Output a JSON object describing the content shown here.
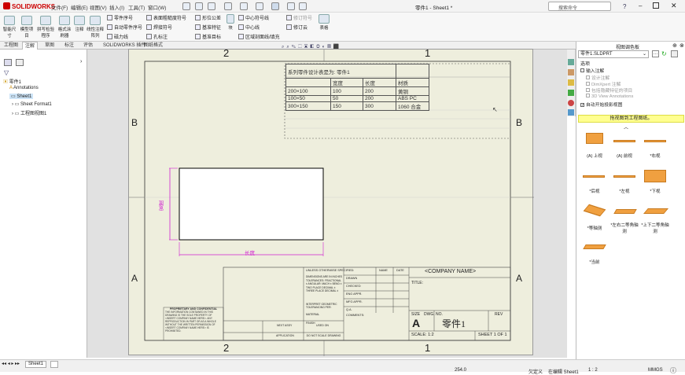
{
  "app": {
    "logo": "SOLIDWORKS",
    "title": "零件1 - Sheet1 *"
  },
  "menus": [
    "文件(F)",
    "编辑(E)",
    "视图(V)",
    "插入(I)",
    "工具(T)",
    "窗口(W)"
  ],
  "search": {
    "placeholder": "搜索命令"
  },
  "ribbon": {
    "big_buttons": [
      "智能尺寸",
      "模型项目",
      "拼写检验程序",
      "格式涂刷器",
      "注释",
      "线性注释阵列"
    ],
    "col1": [
      "零件序号",
      "自动零件序号",
      "磁力线"
    ],
    "col2": [
      "表面粗糙度符号",
      "焊接符号",
      "孔标注"
    ],
    "col3": [
      "形位公差",
      "基准特征",
      "基准目标"
    ],
    "block": "块",
    "col4": [
      "中心符号线",
      "中心线",
      "区域剖面线/填充"
    ],
    "col5": [
      "修订符号",
      "修订云"
    ],
    "table": "表格"
  },
  "command_tabs": [
    "工程图",
    "注解",
    "草图",
    "标注",
    "评估",
    "SOLIDWORKS 插件",
    "图纸格式"
  ],
  "tree": {
    "root": "零件1",
    "items": [
      "Annotations",
      "Sheet1",
      "Sheet Format1",
      "工程图视图1"
    ]
  },
  "sheet": {
    "zone_cols": [
      "2",
      "1"
    ],
    "zone_rows": [
      "B",
      "A"
    ],
    "design_table": {
      "title": "系列零件设计表是为:  零件1",
      "headers": [
        "",
        "宽度",
        "长度",
        "材质"
      ],
      "rows": [
        [
          "200×100",
          "100",
          "200",
          "黄铜"
        ],
        [
          "100×50",
          "50",
          "200",
          "ABS PC"
        ],
        [
          "300×150",
          "150",
          "300",
          "1060 合金"
        ]
      ]
    },
    "dim_width": "宽度",
    "dim_length": "长度",
    "title_block": {
      "company": "<COMPANY NAME>",
      "title_label": "TITLE:",
      "size_label": "SIZE",
      "size": "A",
      "dwg_no_label": "DWG.  NO.",
      "dwg_no": "零件1",
      "rev": "REV",
      "scale": "SCALE: 1:2",
      "sheet": "SHEET 1 OF 1",
      "unless": "UNLESS OTHERWISE SPECIFIED:",
      "name": "NAME",
      "date": "DATE",
      "drawn": "DRAWN",
      "checked": "CHECKED",
      "eng_appr": "ENG APPR.",
      "mfg_appr": "MFG APPR.",
      "qa": "Q.A.",
      "comments": "COMMENTS:",
      "dims": "DIMENSIONS ARE IN INCHES TOLERANCES: FRACTIONAL ± ANGULAR: MACH ±  BEND ± TWO PLACE DECIMAL  ± THREE PLACE DECIMAL  ±",
      "interpret": "INTERPRET GEOMETRIC TOLERANCING PER:",
      "material": "MATERIAL",
      "finish": "FINISH",
      "next_assy": "NEXT ASSY",
      "used_on": "USED ON",
      "application": "APPLICATION",
      "do_not_scale": "DO NOT SCALE DRAWING",
      "proprietary": "PROPRIETARY AND CONFIDENTIAL",
      "prop_text": "THE INFORMATION CONTAINED IN THIS DRAWING IS THE SOLE PROPERTY OF <INSERT COMPANY NAME HERE>. ANY REPRODUCTION IN PART OR AS A WHOLE WITHOUT THE WRITTEN PERMISSION OF <INSERT COMPANY NAME HERE> IS PROHIBITED."
    }
  },
  "view_palette": {
    "title": "视图调色板",
    "file": "零件1.SLDPRT",
    "options": "选项",
    "opts": [
      "输入注解",
      "设计注解",
      "DimXpert 注解",
      "包括隐藏特征的项目",
      "3D View Annotations",
      "自动开始投影视图"
    ],
    "hint": "拖视图到工程图纸。",
    "views": [
      "(A) 上视",
      "(A) 前视",
      "*右视",
      "*后视",
      "*左视",
      "*下视",
      "*等轴测",
      "*左右二等角轴测",
      "*上下二等角轴测",
      "*当前"
    ]
  },
  "status": {
    "tab": "Sheet1",
    "coord": "254.0",
    "state": "欠定义",
    "editing": "在编辑 Sheet1",
    "scale": "1 : 2",
    "units": "MMGS"
  }
}
